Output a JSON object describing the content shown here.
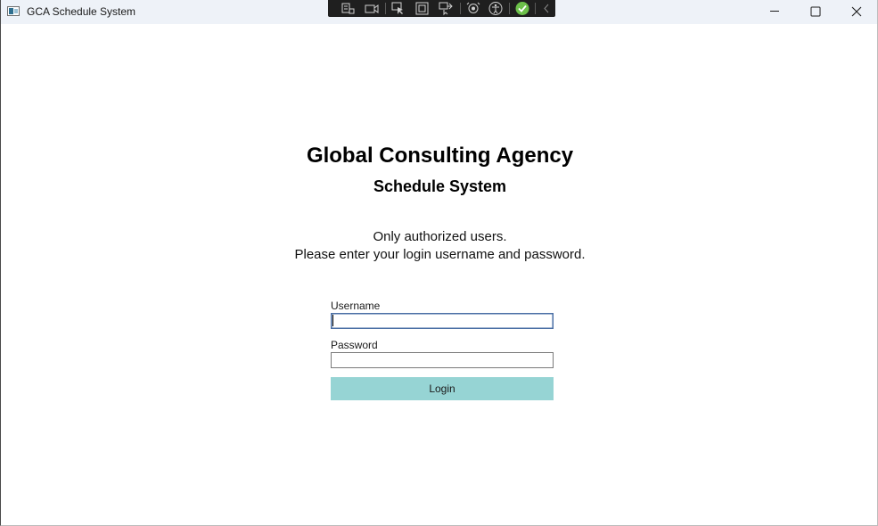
{
  "window": {
    "title": "GCA Schedule System"
  },
  "dev_toolbar": {
    "icons": [
      "live-visual-tree-icon",
      "video-record-icon",
      "select-element-icon",
      "display-layout-adorners-icon",
      "track-focus-icon",
      "hot-reload-icon",
      "accessibility-icon",
      "checkmark-icon",
      "collapse-chevron-icon"
    ]
  },
  "window_controls": {
    "icons": [
      "minimize-icon",
      "maximize-icon",
      "close-icon"
    ]
  },
  "header": {
    "title": "Global Consulting Agency",
    "subtitle": "Schedule System"
  },
  "notice": {
    "line1": "Only authorized users.",
    "line2": "Please enter your login username and password."
  },
  "form": {
    "username_label": "Username",
    "username_value": "",
    "password_label": "Password",
    "password_value": "",
    "login_label": "Login"
  },
  "colors": {
    "titlebar": "#eef2f8",
    "login_button": "#96d4d4",
    "focused_border": "#4a6fa5"
  }
}
